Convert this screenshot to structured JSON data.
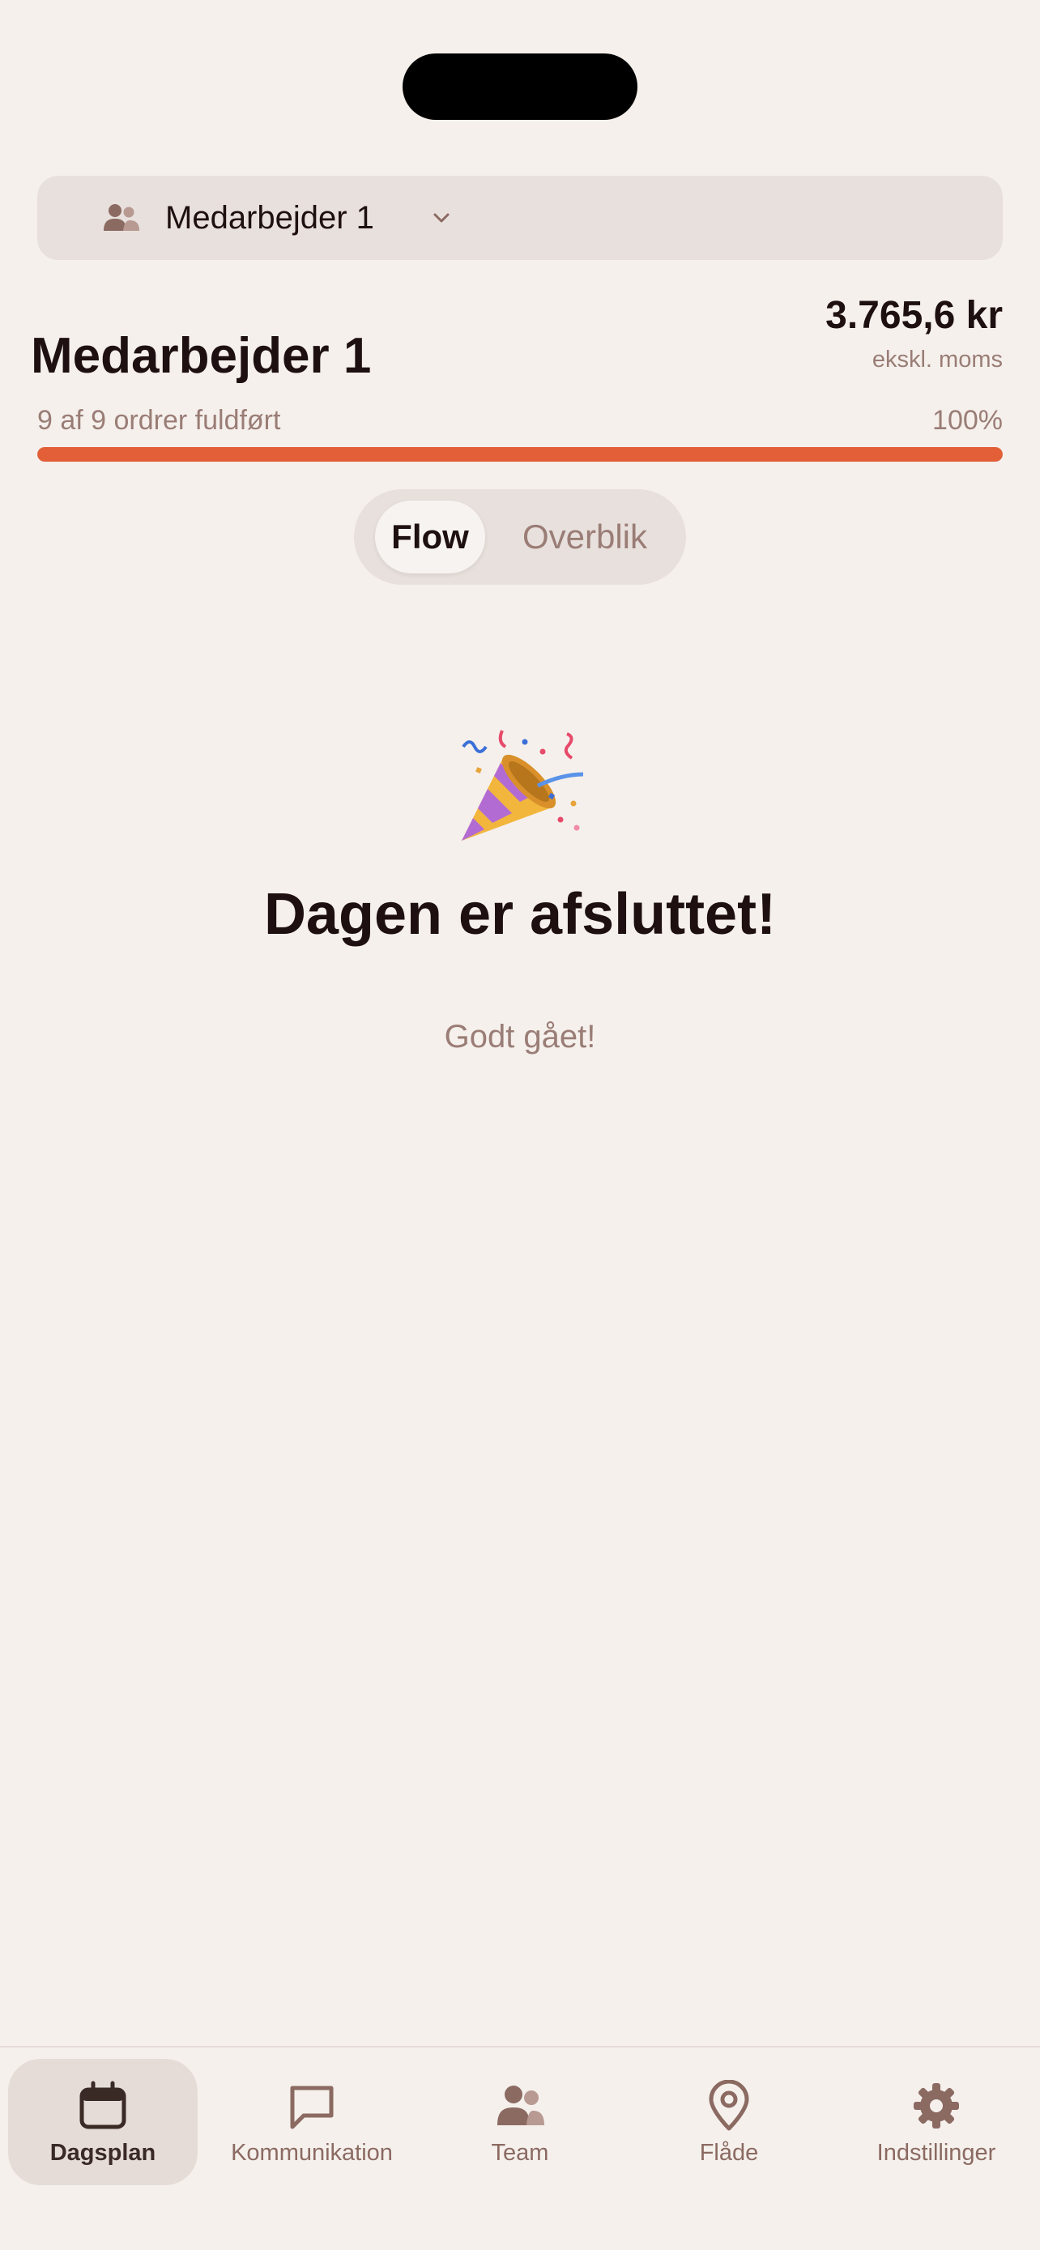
{
  "selector": {
    "label": "Medarbejder 1"
  },
  "summary": {
    "worker_name": "Medarbejder 1",
    "amount": "3.765,6 kr",
    "amount_note": "ekskl. moms",
    "orders_text": "9 af 9 ordrer fuldført",
    "percent_text": "100%",
    "progress_fraction": 1.0
  },
  "view_toggle": {
    "options": [
      "Flow",
      "Overblik"
    ],
    "selected": "Flow"
  },
  "completion": {
    "icon": "party-popper-icon",
    "title": "Dagen er afsluttet!",
    "subtitle": "Godt gået!"
  },
  "tabs": [
    {
      "label": "Dagsplan",
      "icon": "calendar-icon",
      "active": true
    },
    {
      "label": "Kommunikation",
      "icon": "chat-bubble-icon",
      "active": false
    },
    {
      "label": "Team",
      "icon": "people-icon",
      "active": false
    },
    {
      "label": "Flåde",
      "icon": "map-pin-icon",
      "active": false
    },
    {
      "label": "Indstillinger",
      "icon": "gear-icon",
      "active": false
    }
  ],
  "colors": {
    "background": "#f5f0ec",
    "accent": "#e35f38",
    "muted_text": "#9a7d76",
    "tab_icon": "#8b6a62"
  }
}
